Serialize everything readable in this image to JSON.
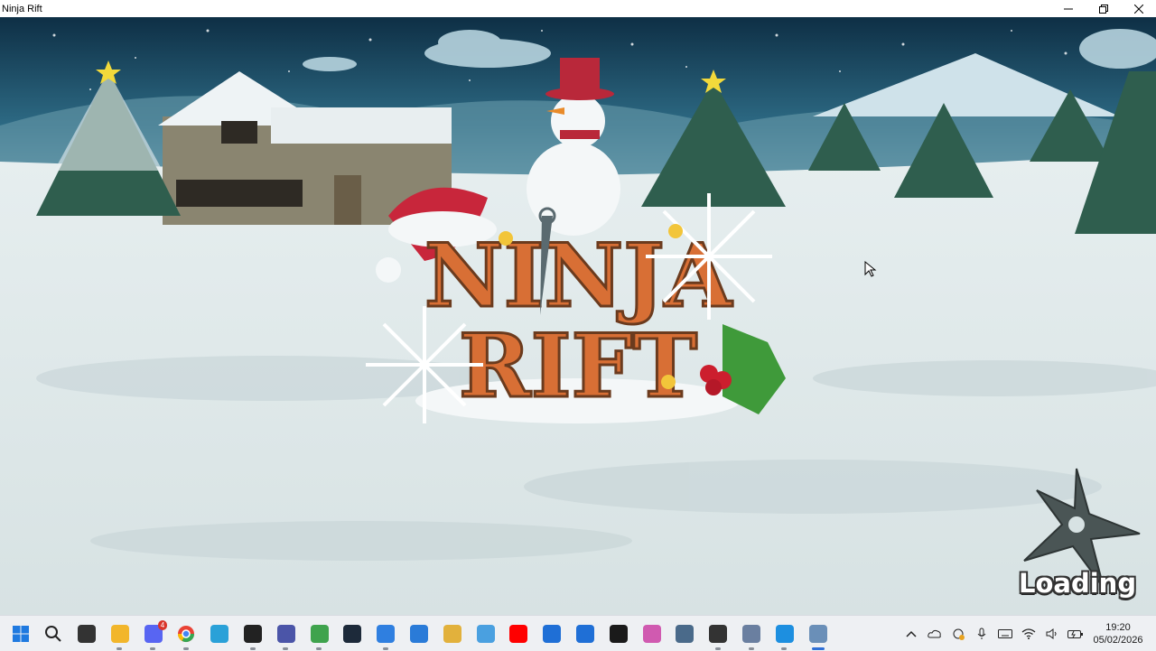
{
  "window": {
    "title": "Ninja Rift",
    "buttons": [
      "minimize",
      "restore",
      "close"
    ]
  },
  "game": {
    "logo_line1": "NINJA",
    "logo_line2": "RIFT",
    "loading_label": "Loading"
  },
  "taskbar": {
    "apps": [
      {
        "name": "start-icon",
        "color": "#1f7ae0"
      },
      {
        "name": "search-icon",
        "color": "#222222"
      },
      {
        "name": "unity-icon",
        "color": "#333333"
      },
      {
        "name": "file-explorer-icon",
        "color": "#f2b62b"
      },
      {
        "name": "discord-icon",
        "color": "#5865f2",
        "badge": "4"
      },
      {
        "name": "chrome-icon",
        "color": "#e94235"
      },
      {
        "name": "edge-icon",
        "color": "#2aa1d8"
      },
      {
        "name": "obs-icon",
        "color": "#222222"
      },
      {
        "name": "editor-icon",
        "color": "#4b55a8"
      },
      {
        "name": "image-editor-icon",
        "color": "#3fa34d"
      },
      {
        "name": "davinci-icon",
        "color": "#1d2a3a"
      },
      {
        "name": "notepad-icon",
        "color": "#2f7fe0"
      },
      {
        "name": "photos-icon",
        "color": "#2a7bd8"
      },
      {
        "name": "paint-icon",
        "color": "#e2b13c"
      },
      {
        "name": "control-panel-icon",
        "color": "#4aa0e0"
      },
      {
        "name": "youtube-icon",
        "color": "#ff0000"
      },
      {
        "name": "vscode-icon",
        "color": "#1f6fd6"
      },
      {
        "name": "defender-icon",
        "color": "#1f6fd6"
      },
      {
        "name": "epic-games-icon",
        "color": "#1a1a1a"
      },
      {
        "name": "copilot-icon",
        "color": "#d05ab0"
      },
      {
        "name": "settings-icon",
        "color": "#4a6a8a"
      },
      {
        "name": "inkscape-icon",
        "color": "#333333"
      },
      {
        "name": "game-preview-icon",
        "color": "#6a7fa0"
      },
      {
        "name": "app-store-icon",
        "color": "#1d8fe0"
      },
      {
        "name": "ninja-rift-icon",
        "color": "#6a8fb8"
      }
    ],
    "tray_icons": [
      "chevron-up-icon",
      "onedrive-icon",
      "sync-icon",
      "microphone-icon",
      "keyboard-icon",
      "wifi-icon",
      "speaker-icon",
      "battery-icon"
    ],
    "time": "19:20",
    "date": "05/02/2026"
  }
}
